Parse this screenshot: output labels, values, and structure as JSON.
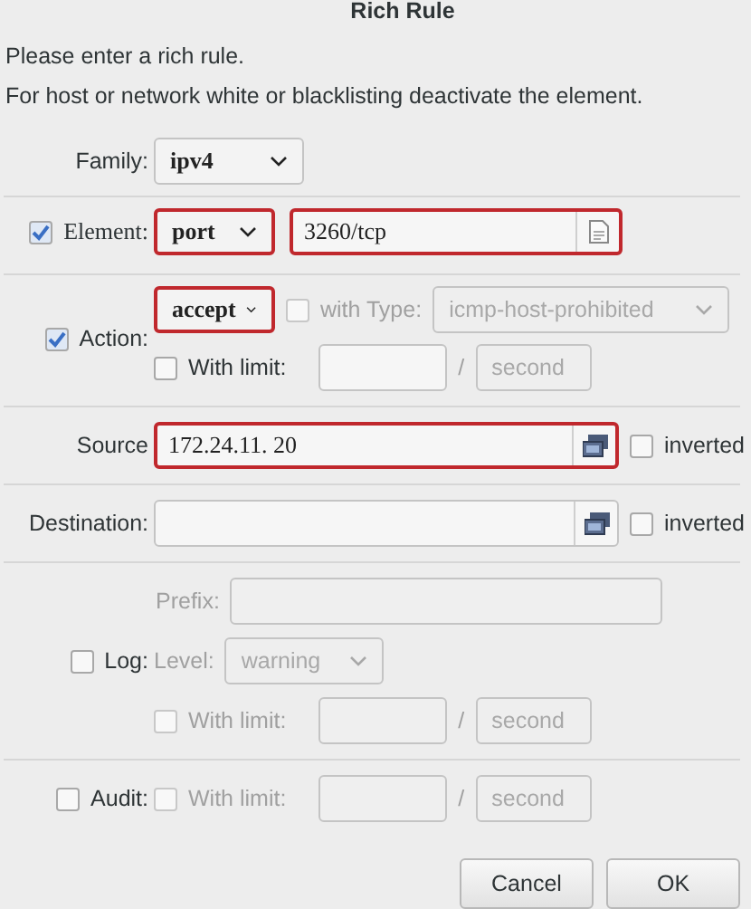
{
  "window": {
    "title": "Rich Rule"
  },
  "intro": [
    "Please enter a rich rule.",
    "For host or network white or blacklisting deactivate the element."
  ],
  "family": {
    "label": "Family:",
    "value": "ipv4"
  },
  "element": {
    "label": "Element:",
    "checked": true,
    "type": {
      "value": "port",
      "highlighted": true
    },
    "entry": {
      "value": "3260/tcp",
      "highlighted": true
    }
  },
  "action": {
    "label": "Action:",
    "checked": true,
    "type": {
      "value": "accept",
      "highlighted": true
    },
    "with_type": {
      "label": "with Type:",
      "checked": false,
      "disabled": true,
      "value": "icmp-host-prohibited"
    },
    "limit": {
      "label": "With limit:",
      "checked": false,
      "disabled": false,
      "separator": "/",
      "unit": "second"
    }
  },
  "source": {
    "label": "Source",
    "value": "172.24.11. 20",
    "highlighted": true,
    "inverted": {
      "label": "inverted",
      "checked": false
    }
  },
  "destination": {
    "label": "Destination:",
    "highlighted": false,
    "inverted": {
      "label": "inverted",
      "checked": false
    }
  },
  "log": {
    "label": "Log:",
    "checked": false,
    "prefix": {
      "label": "Prefix:",
      "disabled": true
    },
    "level": {
      "label": "Level:",
      "value": "warning",
      "disabled": true
    },
    "limit": {
      "label": "With limit:",
      "checked": false,
      "disabled": true,
      "separator": "/",
      "unit": "second"
    }
  },
  "audit": {
    "label": "Audit:",
    "checked": false,
    "limit": {
      "label": "With limit:",
      "checked": false,
      "disabled": true,
      "separator": "/",
      "unit": "second"
    }
  },
  "buttons": [
    "Cancel",
    "OK"
  ]
}
